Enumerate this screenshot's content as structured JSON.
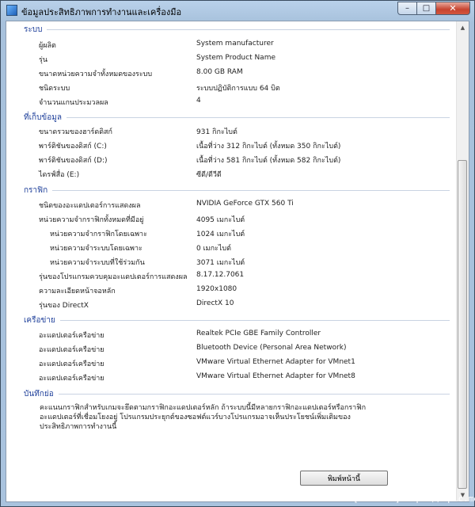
{
  "window": {
    "title": "ข้อมูลประสิทธิภาพการทำงานและเครื่องมือ",
    "min": "–",
    "max": "□",
    "close": "✕"
  },
  "sections": {
    "system": {
      "header": "ระบบ",
      "rows": [
        {
          "label": "ผู้ผลิต",
          "value": "System manufacturer"
        },
        {
          "label": "รุ่น",
          "value": "System Product Name"
        },
        {
          "label": "ขนาดหน่วยความจำทั้งหมดของระบบ",
          "value": "8.00 GB RAM"
        },
        {
          "label": "ชนิดระบบ",
          "value": "ระบบปฏิบัติการแบบ 64 บิต"
        },
        {
          "label": "จำนวนแกนประมวลผล",
          "value": "4"
        }
      ]
    },
    "storage": {
      "header": "ที่เก็บข้อมูล",
      "rows": [
        {
          "label": "ขนาดรวมของฮาร์ดดิสก์",
          "value": "931 กิกะไบต์"
        },
        {
          "label": "พาร์ติชันของดิสก์ (C:)",
          "value": "เนื้อที่ว่าง 312 กิกะไบต์ (ทั้งหมด 350 กิกะไบต์)"
        },
        {
          "label": "พาร์ติชันของดิสก์ (D:)",
          "value": "เนื้อที่ว่าง 581 กิกะไบต์ (ทั้งหมด 582 กิกะไบต์)"
        },
        {
          "label": "ไดรฟ์สื่อ (E:)",
          "value": "ซีดี/ดีวีดี"
        }
      ]
    },
    "graphics": {
      "header": "กราฟิก",
      "rows": [
        {
          "label": "ชนิดของอะแดปเตอร์การแสดงผล",
          "value": "NVIDIA GeForce GTX 560 Ti"
        },
        {
          "label": "หน่วยความจำกราฟิกทั้งหมดที่มีอยู่",
          "value": "4095 เมกะไบต์"
        },
        {
          "label": "หน่วยความจำกราฟิกโดยเฉพาะ",
          "value": "1024 เมกะไบต์"
        },
        {
          "label": "หน่วยความจำระบบโดยเฉพาะ",
          "value": "0 เมกะไบต์"
        },
        {
          "label": "หน่วยความจำระบบที่ใช้ร่วมกัน",
          "value": "3071 เมกะไบต์"
        },
        {
          "label": "รุ่นของโปรแกรมควบคุมอะแดปเตอร์การแสดงผล",
          "value": "8.17.12.7061"
        },
        {
          "label": "ความละเอียดหน้าจอหลัก",
          "value": "1920x1080"
        },
        {
          "label": "รุ่นของ DirectX",
          "value": "DirectX 10"
        }
      ]
    },
    "network": {
      "header": "เครือข่าย",
      "rows": [
        {
          "label": "อะแดปเตอร์เครือข่าย",
          "value": "Realtek PCIe GBE Family Controller"
        },
        {
          "label": "อะแดปเตอร์เครือข่าย",
          "value": "Bluetooth Device (Personal Area Network)"
        },
        {
          "label": "อะแดปเตอร์เครือข่าย",
          "value": "VMware Virtual Ethernet Adapter for VMnet1"
        },
        {
          "label": "อะแดปเตอร์เครือข่าย",
          "value": "VMware Virtual Ethernet Adapter for VMnet8"
        }
      ]
    },
    "notes": {
      "header": "บันทึกย่อ",
      "text": "คะแนนกราฟิกสำหรับเกมจะยึดตามกราฟิกอะแดปเตอร์หลัก ถ้าระบบนี้มีหลายกราฟิกอะแดปเตอร์หรือกราฟิกอะแดปเตอร์ที่เชื่อมโยงอยู่ โปรแกรมประยุกต์ของซอฟต์แวร์บางโปรแกรมอาจเห็นประโยชน์เพิ่มเติมของประสิทธิภาพการทำงานนี้"
    }
  },
  "print_button": "พิมพ์หน้านี้",
  "watermark": "[801x831]https://upic.me/"
}
